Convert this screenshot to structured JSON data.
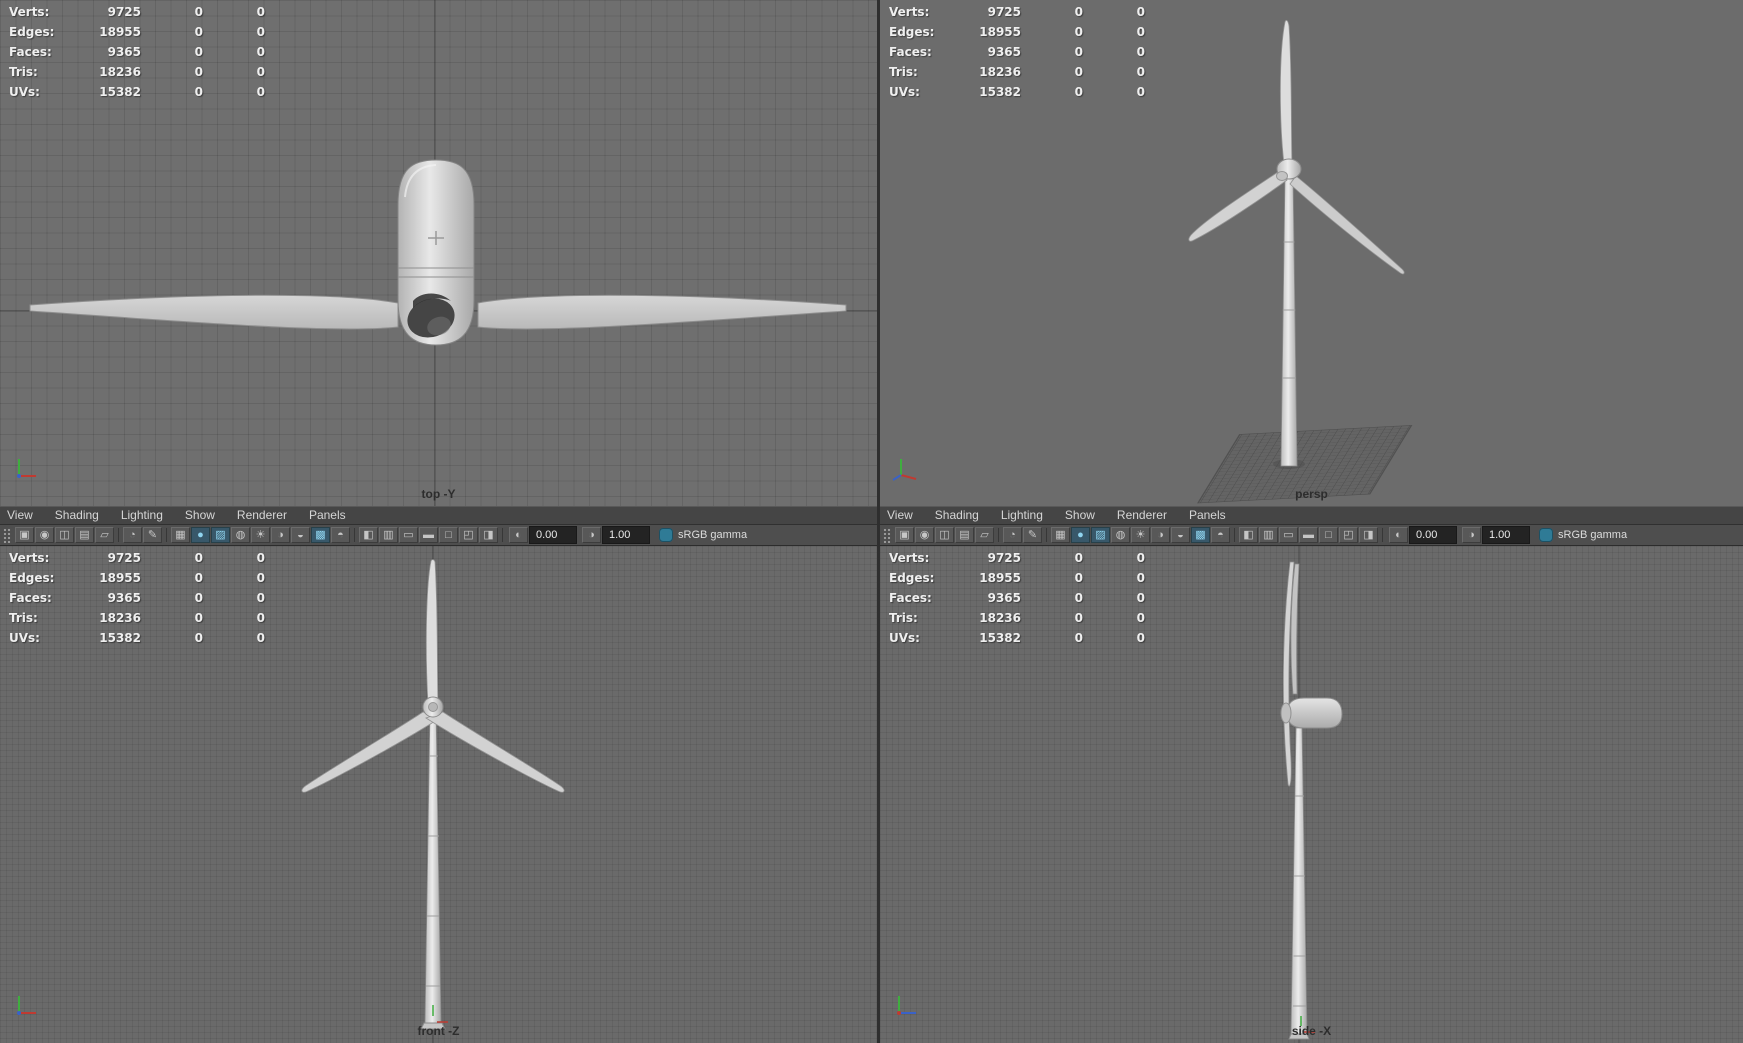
{
  "colors": {
    "viewport_bg": "#6c6c6c",
    "viewport_bg_top": "#6f6f6f",
    "grid_line": "#5f5f5f",
    "panel_menu_bg": "#454545",
    "toolbar_bg": "#4e4e4e",
    "accent_teal": "#53b0cf",
    "field_bg": "#232323",
    "hud_text": "#efefef",
    "view_label_text": "#2d2d2d",
    "axis_x_red": "#c03a31",
    "axis_y_green": "#3fae3f",
    "axis_z_blue": "#3a62c8",
    "model_gray": "#d8d8d8"
  },
  "hud": {
    "rows": [
      {
        "label": "Verts:",
        "total": "9725",
        "col2": "0",
        "col3": "0"
      },
      {
        "label": "Edges:",
        "total": "18955",
        "col2": "0",
        "col3": "0"
      },
      {
        "label": "Faces:",
        "total": "9365",
        "col2": "0",
        "col3": "0"
      },
      {
        "label": "Tris:",
        "total": "18236",
        "col2": "0",
        "col3": "0"
      },
      {
        "label": "UVs:",
        "total": "15382",
        "col2": "0",
        "col3": "0"
      }
    ]
  },
  "viewports": {
    "top": {
      "label": "top -Y"
    },
    "persp": {
      "label": "persp"
    },
    "front": {
      "label": "front -Z"
    },
    "side": {
      "label": "side -X"
    }
  },
  "panel_menu": {
    "items": [
      "View",
      "Shading",
      "Lighting",
      "Show",
      "Renderer",
      "Panels"
    ]
  },
  "toolbar": {
    "items": [
      {
        "type": "grip",
        "name": "panel-grip"
      },
      {
        "type": "icon",
        "name": "select-camera-icon",
        "glyph": "▣"
      },
      {
        "type": "icon",
        "name": "lock-camera-icon",
        "glyph": "◉"
      },
      {
        "type": "icon",
        "name": "camera-attributes-icon",
        "glyph": "◫"
      },
      {
        "type": "icon",
        "name": "bookmark-icon",
        "glyph": "▤"
      },
      {
        "type": "icon",
        "name": "image-plane-icon",
        "glyph": "▱"
      },
      {
        "type": "sep"
      },
      {
        "type": "icon",
        "name": "two-d-pan-zoom-icon",
        "glyph": "◔"
      },
      {
        "type": "icon",
        "name": "grease-pencil-icon",
        "glyph": "✎"
      },
      {
        "type": "sep"
      },
      {
        "type": "icon",
        "name": "wireframe-icon",
        "glyph": "▦"
      },
      {
        "type": "icon",
        "name": "smooth-shade-icon",
        "glyph": "●",
        "active": true
      },
      {
        "type": "icon",
        "name": "textured-icon",
        "glyph": "▨",
        "active": true
      },
      {
        "type": "icon",
        "name": "use-default-material-icon",
        "glyph": "◍"
      },
      {
        "type": "icon",
        "name": "lights-icon",
        "glyph": "☀"
      },
      {
        "type": "icon",
        "name": "shadows-icon",
        "glyph": "◑"
      },
      {
        "type": "icon",
        "name": "occlusion-icon",
        "glyph": "◒"
      },
      {
        "type": "icon",
        "name": "anti-alias-icon",
        "glyph": "▩",
        "active": true
      },
      {
        "type": "icon",
        "name": "motion-blur-icon",
        "glyph": "◓"
      },
      {
        "type": "sep"
      },
      {
        "type": "icon",
        "name": "isolate-select-icon",
        "glyph": "◧"
      },
      {
        "type": "icon",
        "name": "field-chart-icon",
        "glyph": "▥"
      },
      {
        "type": "icon",
        "name": "resolution-gate-icon",
        "glyph": "▭"
      },
      {
        "type": "icon",
        "name": "gate-mask-icon",
        "glyph": "▬"
      },
      {
        "type": "icon",
        "name": "film-gate-icon",
        "glyph": "□"
      },
      {
        "type": "icon",
        "name": "safe-action-icon",
        "glyph": "◰"
      },
      {
        "type": "icon",
        "name": "safe-title-icon",
        "glyph": "◨"
      },
      {
        "type": "sep"
      },
      {
        "type": "field",
        "name": "exposure-field",
        "icon": "◐",
        "value": "0.00"
      },
      {
        "type": "field",
        "name": "gamma-field",
        "icon": "◑",
        "value": "1.00"
      },
      {
        "type": "label",
        "name": "view-transform",
        "value": "sRGB gamma"
      }
    ]
  }
}
